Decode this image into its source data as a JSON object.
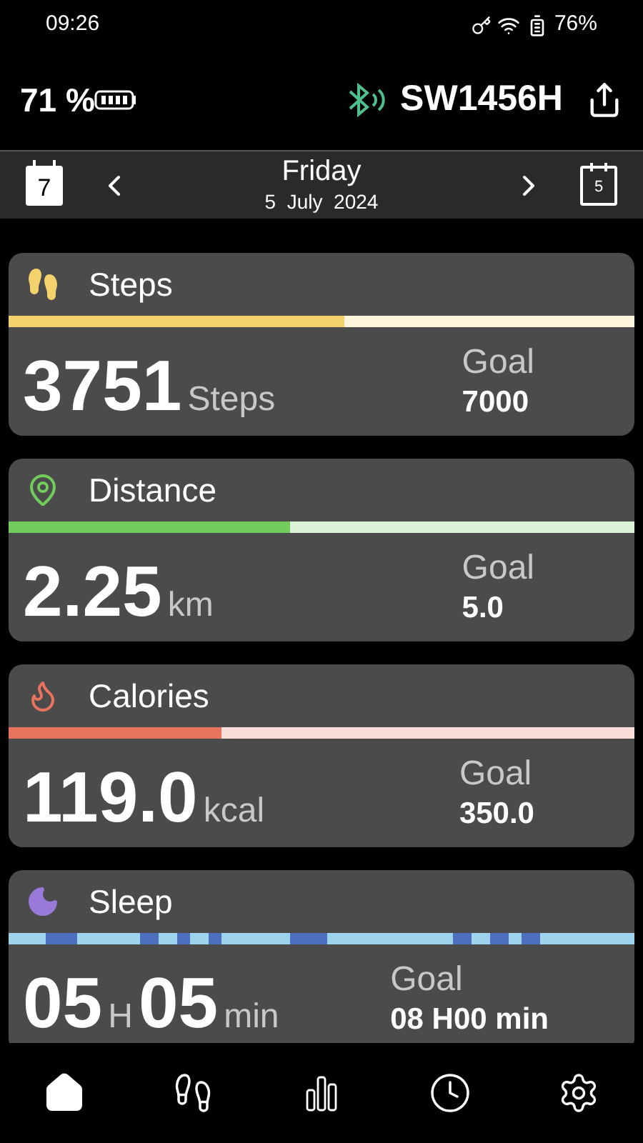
{
  "status_bar": {
    "time": "09:26",
    "battery": "76%"
  },
  "header": {
    "watch_battery": "71 %",
    "device_name": "SW1456H"
  },
  "date_bar": {
    "prev_calendar": "7",
    "day": "Friday",
    "date": "5  July  2024",
    "next_calendar": "5"
  },
  "cards": [
    {
      "kind": "steps",
      "title": "Steps",
      "color": "#f3d26e",
      "level": 0.536,
      "value": [
        {
          "kind": "number",
          "text": "3751"
        },
        {
          "kind": "unit",
          "text": "Steps"
        }
      ],
      "goal_label": "Goal",
      "goal": "7000"
    },
    {
      "kind": "distance",
      "title": "Distance",
      "color": "#72cc5c",
      "level": 0.45,
      "value": [
        {
          "kind": "number",
          "text": "2.25"
        },
        {
          "kind": "unit",
          "text": "km"
        }
      ],
      "goal_label": "Goal",
      "goal": "5.0"
    },
    {
      "kind": "calories",
      "title": "Calories",
      "color": "#e8735e",
      "level": 0.34,
      "value": [
        {
          "kind": "number",
          "text": "119.0"
        },
        {
          "kind": "unit",
          "text": "kcal"
        }
      ],
      "goal_label": "Goal",
      "goal": "350.0"
    },
    {
      "kind": "sleep",
      "title": "Sleep",
      "color": "#9a7ad8",
      "value": [
        {
          "kind": "number",
          "text": "05"
        },
        {
          "kind": "unit",
          "text": "H"
        },
        {
          "kind": "number",
          "text": "05"
        },
        {
          "kind": "unit",
          "text": "min"
        }
      ],
      "goal_label": "Goal",
      "goal": "08 H00 min"
    }
  ],
  "nav": [
    {
      "kind": "home",
      "selected": true
    },
    {
      "kind": "activity",
      "selected": false
    },
    {
      "kind": "stats",
      "selected": false
    },
    {
      "kind": "clock",
      "selected": false
    },
    {
      "kind": "settings",
      "selected": false
    }
  ]
}
